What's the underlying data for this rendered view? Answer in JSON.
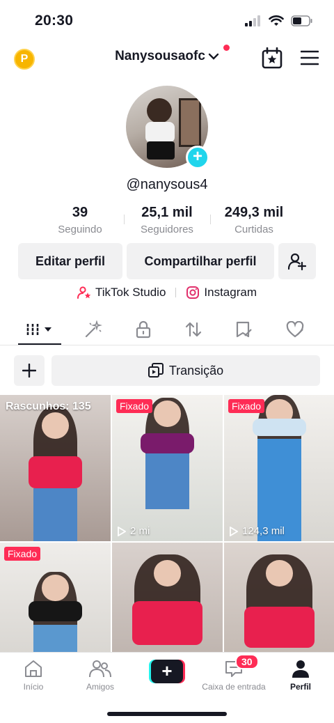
{
  "status_bar": {
    "time": "20:30"
  },
  "header": {
    "coin_label": "P",
    "username": "Nanysousaofc"
  },
  "profile": {
    "handle": "@nanysous4"
  },
  "stats": [
    {
      "value": "39",
      "label": "Seguindo"
    },
    {
      "value": "25,1 mil",
      "label": "Seguidores"
    },
    {
      "value": "249,3 mil",
      "label": "Curtidas"
    }
  ],
  "buttons": {
    "edit": "Editar perfil",
    "share": "Compartilhar perfil"
  },
  "links": {
    "studio": "TikTok Studio",
    "instagram": "Instagram"
  },
  "actions": {
    "transition": "Transição"
  },
  "videos": [
    {
      "overlay": "Rascunhos: 135",
      "views": ""
    },
    {
      "overlay": "Fixado",
      "views": "2 mi"
    },
    {
      "overlay": "Fixado",
      "views": "124,3 mil"
    },
    {
      "overlay": "Fixado",
      "views": ""
    },
    {
      "overlay": "",
      "views": ""
    },
    {
      "overlay": "",
      "views": ""
    }
  ],
  "nav": {
    "home": "Início",
    "friends": "Amigos",
    "inbox": "Caixa de entrada",
    "inbox_badge": "30",
    "profile": "Perfil"
  },
  "colors": {
    "accent": "#fe2c55",
    "cyan": "#20d5ec"
  }
}
